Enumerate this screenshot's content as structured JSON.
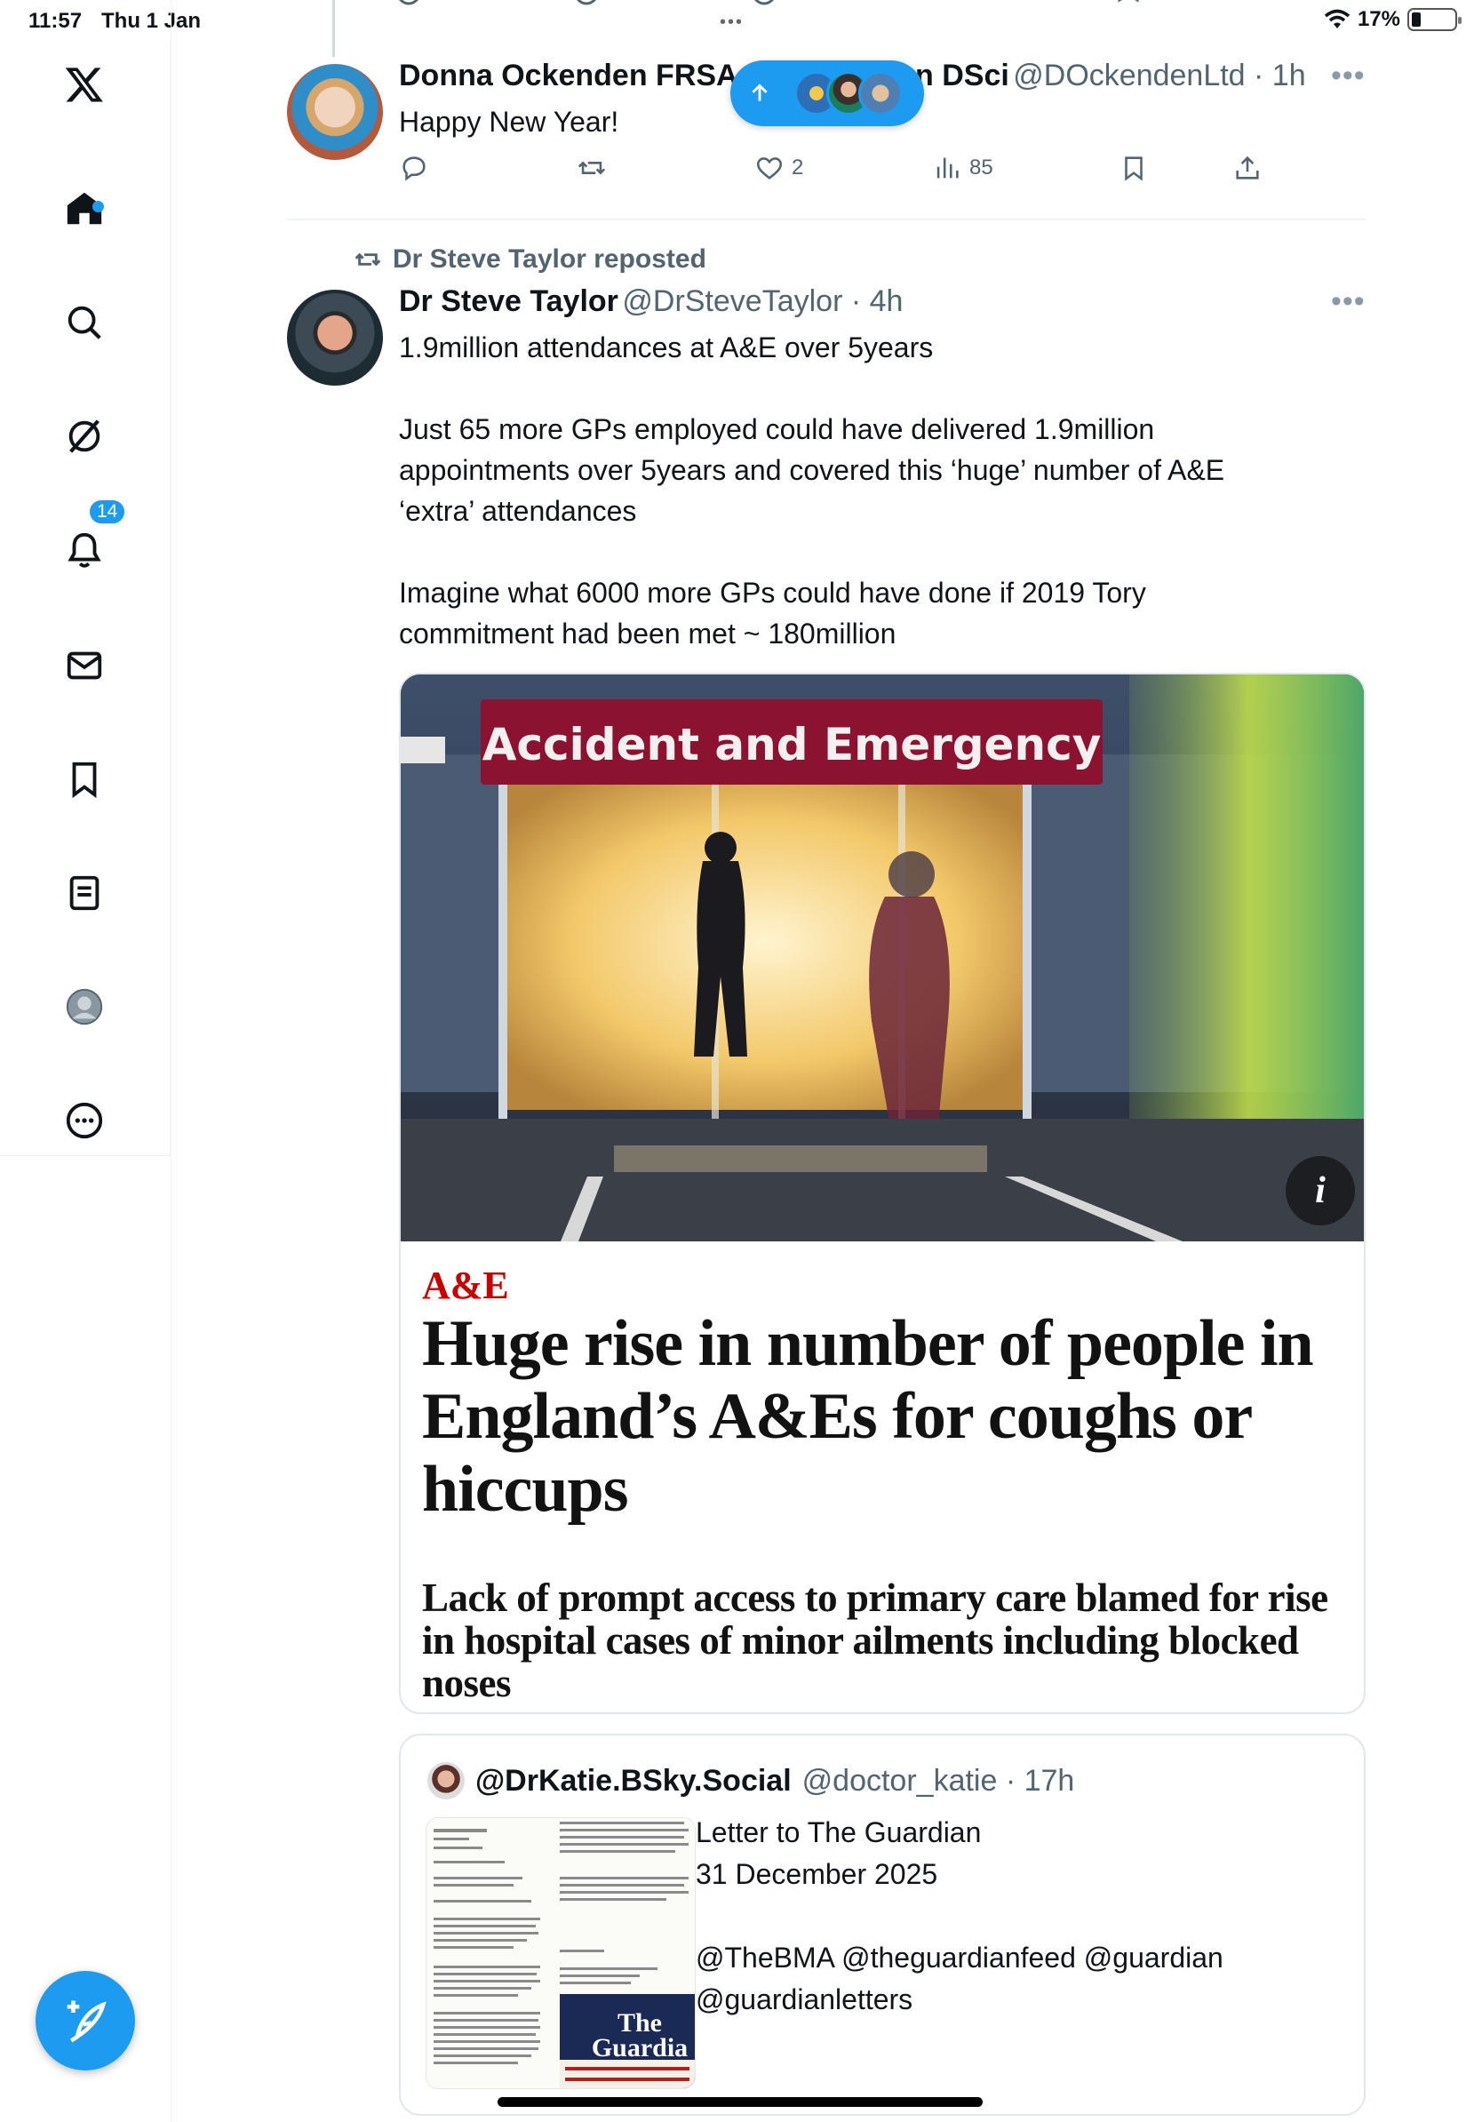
{
  "status_bar": {
    "time": "11:57",
    "date": "Thu 1 Jan",
    "battery": "17%"
  },
  "sidebar": {
    "items": [
      {
        "name": "home",
        "icon": "home-icon"
      },
      {
        "name": "explore",
        "icon": "search-icon"
      },
      {
        "name": "grok",
        "icon": "grok-icon"
      },
      {
        "name": "notifications",
        "icon": "bell-icon",
        "badge": "14"
      },
      {
        "name": "messages",
        "icon": "envelope-icon"
      },
      {
        "name": "bookmarks",
        "icon": "bookmark-icon"
      },
      {
        "name": "lists",
        "icon": "list-icon"
      },
      {
        "name": "profile",
        "icon": "profile-icon"
      },
      {
        "name": "more",
        "icon": "more-circle-icon"
      }
    ]
  },
  "tweet1": {
    "name_left": "Donna Ockenden FRSA",
    "name_right": "n DSci",
    "handle_time": "@DOckendenLtd · 1h",
    "text": "Happy New Year!",
    "likes": "2",
    "views": "85"
  },
  "tweet2": {
    "repost_label": "Dr Steve Taylor reposted",
    "name": "Dr Steve Taylor",
    "handle_time": "@DrSteveTaylor · 4h",
    "text": "1.9million attendances at A&E over 5years\n\nJust 65 more GPs employed could have delivered 1.9million\nappointments over 5years and covered this ‘huge’ number of A&E\n‘extra’ attendances\n\nImagine what 6000 more GPs could have done if 2019 Tory\ncommitment had been met ~ 180million",
    "card": {
      "photo_sign": "Accident and Emergency",
      "kicker": "A&E",
      "headline": "Huge rise in number of people in England’s A&Es for coughs or hiccups",
      "standfirst": "Lack of prompt access to primary care blamed for rise in hospital cases of minor ailments including blocked noses"
    },
    "quote": {
      "name": "@DrKatie.BSky.Social",
      "handle_time": "@doctor_katie · 17h",
      "text": "Letter to The Guardian\n31 December 2025\n\n@TheBMA @theguardianfeed @guardian\n@guardianletters"
    }
  },
  "colors": {
    "accent": "#1d9bf0",
    "text": "#0f1419",
    "muted": "#536471",
    "guardian_red": "#c70000"
  }
}
